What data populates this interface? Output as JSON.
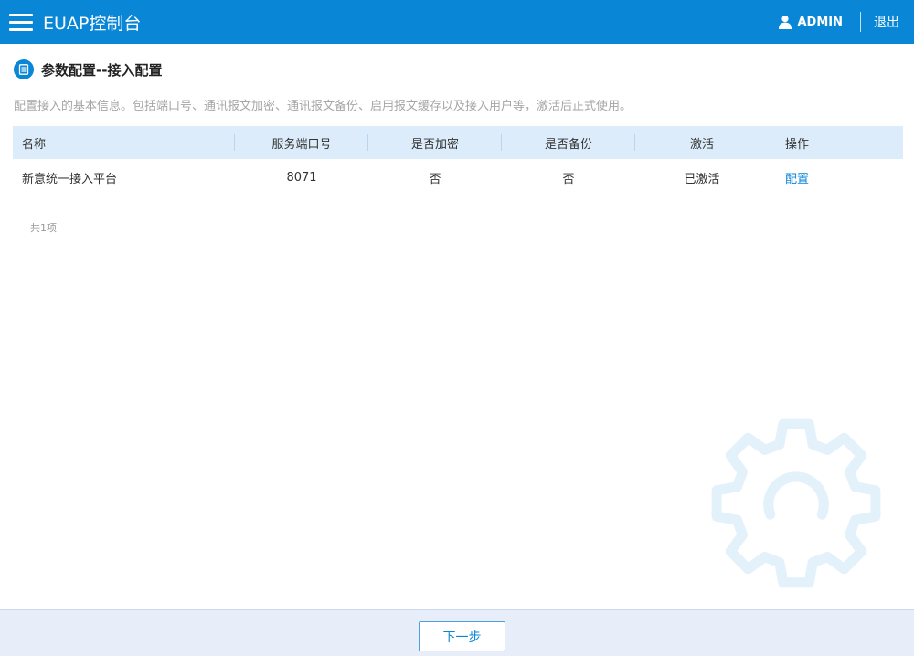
{
  "header": {
    "app_title": "EUAP控制台",
    "user_name": "ADMIN",
    "logout_label": "退出",
    "menu_icon": "hamburger-menu-icon",
    "user_icon": "user-icon"
  },
  "page": {
    "title": "参数配置--接入配置",
    "description": "配置接入的基本信息。包括端口号、通讯报文加密、通讯报文备份、启用报文缓存以及接入用户等，激活后正式使用。"
  },
  "table": {
    "headers": [
      "名称",
      "服务端口号",
      "是否加密",
      "是否备份",
      "激活",
      "操作"
    ],
    "rows": [
      {
        "name": "新意统一接入平台",
        "port": "8071",
        "encrypted": "否",
        "backup": "否",
        "status": "已激活",
        "action": "配置"
      }
    ],
    "count_text": "共1项"
  },
  "footer": {
    "next_label": "下一步"
  },
  "colors": {
    "primary": "#0a86d6",
    "table_header_bg": "#dcecfa",
    "footer_bg": "#e7edf9",
    "watermark": "#e3f1fb"
  }
}
